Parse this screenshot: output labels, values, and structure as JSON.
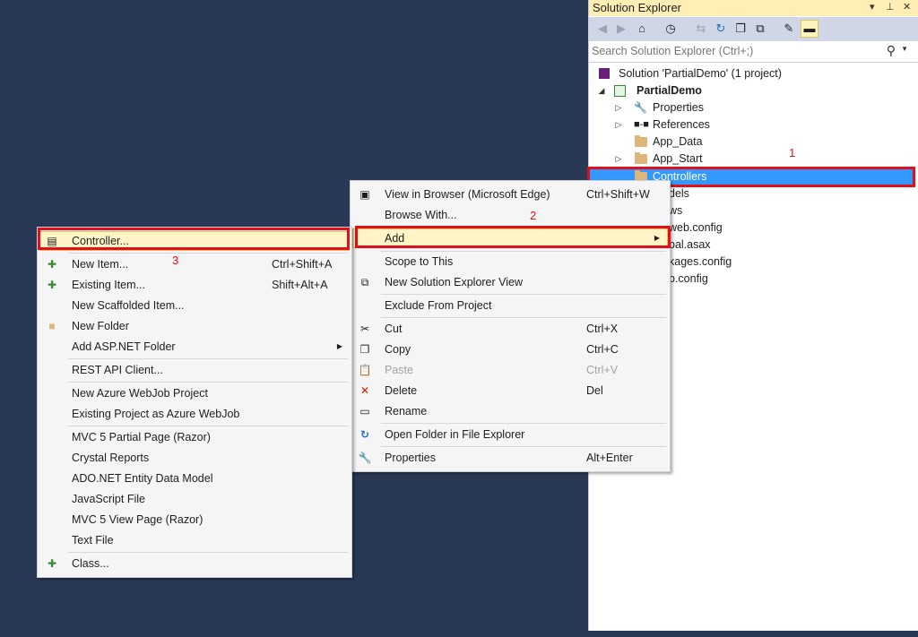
{
  "solution_explorer": {
    "title": "Solution Explorer",
    "title_controls": [
      "▾",
      "⊥",
      "✕"
    ],
    "search_placeholder": "Search Solution Explorer (Ctrl+;)",
    "tree": {
      "solution": "Solution 'PartialDemo' (1 project)",
      "project": "PartialDemo",
      "properties": "Properties",
      "references": "References",
      "app_data": "App_Data",
      "app_start": "App_Start",
      "controllers": "Controllers",
      "models_partial": "dels",
      "views_partial": "ws",
      "webconfig_partial": "web.config",
      "global_partial": "bal.asax",
      "packages_partial": "kages.config",
      "webconfig2_partial": "b.config"
    }
  },
  "annotations": {
    "step1": "1",
    "step2": "2",
    "step3": "3"
  },
  "context_menu": {
    "items": {
      "view_in_browser": {
        "label": "View in Browser (Microsoft Edge)",
        "shortcut": "Ctrl+Shift+W"
      },
      "browse_with": {
        "label": "Browse With..."
      },
      "add": {
        "label": "Add"
      },
      "scope_to_this": {
        "label": "Scope to This"
      },
      "new_se_view": {
        "label": "New Solution Explorer View"
      },
      "exclude": {
        "label": "Exclude From Project"
      },
      "cut": {
        "label": "Cut",
        "shortcut": "Ctrl+X"
      },
      "copy": {
        "label": "Copy",
        "shortcut": "Ctrl+C"
      },
      "paste": {
        "label": "Paste",
        "shortcut": "Ctrl+V"
      },
      "delete": {
        "label": "Delete",
        "shortcut": "Del"
      },
      "rename": {
        "label": "Rename"
      },
      "open_folder": {
        "label": "Open Folder in File Explorer"
      },
      "properties": {
        "label": "Properties",
        "shortcut": "Alt+Enter"
      }
    }
  },
  "add_submenu": {
    "items": {
      "controller": {
        "label": "Controller..."
      },
      "new_item": {
        "label": "New Item...",
        "shortcut": "Ctrl+Shift+A"
      },
      "existing_item": {
        "label": "Existing Item...",
        "shortcut": "Shift+Alt+A"
      },
      "new_scaffolded": {
        "label": "New Scaffolded Item..."
      },
      "new_folder": {
        "label": "New Folder"
      },
      "add_aspnet_folder": {
        "label": "Add ASP.NET Folder"
      },
      "rest_api": {
        "label": "REST API Client..."
      },
      "new_webjob": {
        "label": "New Azure WebJob Project"
      },
      "existing_webjob": {
        "label": "Existing Project as Azure WebJob"
      },
      "mvc_partial": {
        "label": "MVC 5 Partial Page (Razor)"
      },
      "crystal": {
        "label": "Crystal Reports"
      },
      "adonet": {
        "label": "ADO.NET Entity Data Model"
      },
      "js_file": {
        "label": "JavaScript File"
      },
      "mvc_view": {
        "label": "MVC 5 View Page (Razor)"
      },
      "text_file": {
        "label": "Text File"
      },
      "class": {
        "label": "Class..."
      }
    }
  },
  "colors": {
    "background": "#293955",
    "selection": "#3399ff",
    "highlight_box": "#e3101c",
    "menu_hover": "#fff4c5"
  }
}
